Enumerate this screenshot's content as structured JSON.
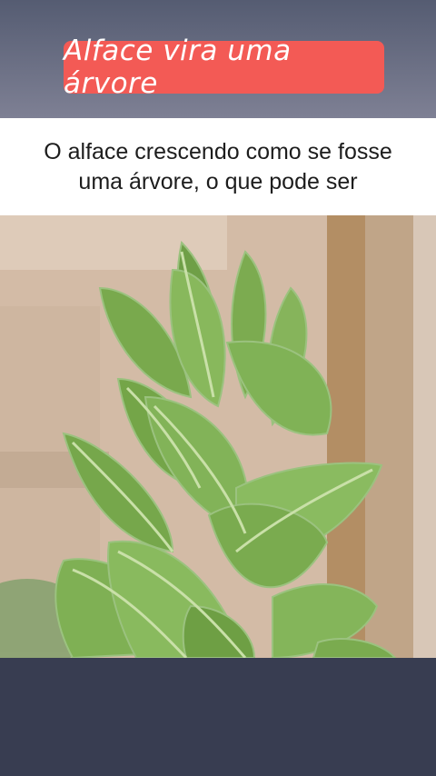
{
  "title_banner": {
    "text": "Alface vira uma árvore",
    "color": "#f35a55"
  },
  "caption": {
    "text": "O alface crescendo como se fosse uma árvore, o que pode ser"
  },
  "photo": {
    "subject": "lettuce-plant"
  }
}
